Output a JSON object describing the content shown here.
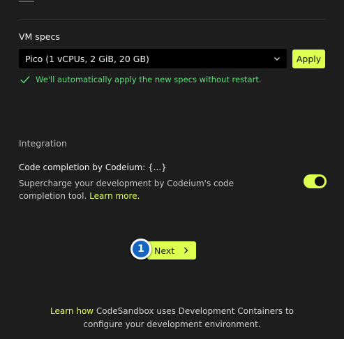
{
  "vm_specs": {
    "label": "VM specs",
    "selected_value": "Pico (1 vCPUs, 2 GiB, 20 GB)",
    "apply_label": "Apply",
    "note": "We'll automatically apply the new specs without restart."
  },
  "integration": {
    "heading": "Integration",
    "codeium": {
      "title": "Code completion by Codeium: {...}",
      "description": "Supercharge your development by Codeium's code completion tool.",
      "link_label": "Learn more.",
      "enabled": true
    }
  },
  "actions": {
    "next_label": "Next",
    "step_badge": "1"
  },
  "footer": {
    "link_label": "Learn how",
    "text_line1": " CodeSandbox uses Development Containers to",
    "text_line2": "configure your development environment."
  },
  "colors": {
    "background": "#1d1d1d",
    "accent": "#dcff50",
    "success": "#5ee07a",
    "step_badge": "#1565c0"
  },
  "icons": {
    "select_chevron": "chevron-down-icon",
    "success_check": "check-icon",
    "next_chevron": "chevron-right-icon"
  }
}
